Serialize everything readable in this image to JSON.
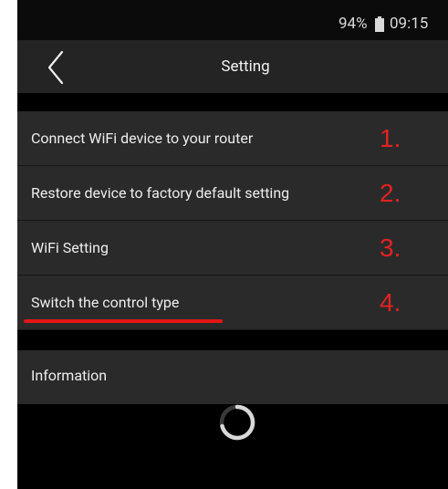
{
  "status_bar": {
    "battery_percent": "94%",
    "battery_icon": "battery-icon",
    "time": "09:15"
  },
  "header": {
    "back_icon": "chevron-left-icon",
    "title": "Setting"
  },
  "settings_list": [
    {
      "label": "Connect WiFi device to your router",
      "annotation": "1."
    },
    {
      "label": "Restore device to factory default setting",
      "annotation": "2."
    },
    {
      "label": "WiFi Setting",
      "annotation": "3."
    },
    {
      "label": "Switch the control type",
      "annotation": "4."
    }
  ],
  "info": {
    "label": "Information"
  },
  "colors": {
    "annotation_red": "#e32222",
    "row_background": "#2a2a2a",
    "header_background": "#242424",
    "screen_background": "#000000"
  },
  "loading_icon": "loading-spinner-icon"
}
